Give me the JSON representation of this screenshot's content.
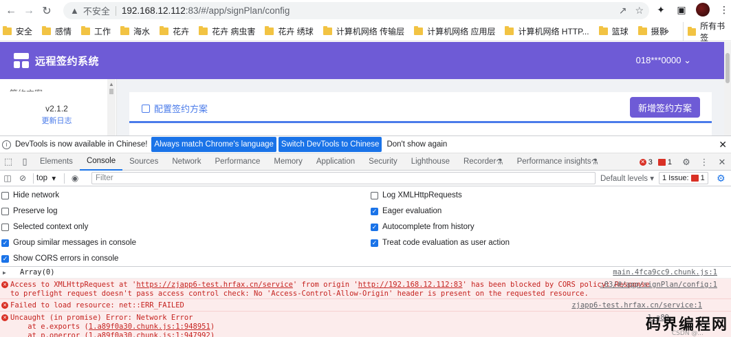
{
  "browser": {
    "not_secure": "不安全",
    "url_host": "192.168.12.112",
    "url_rest": ":83/#/app/signPlan/config",
    "bookmarks": [
      "安全",
      "感情",
      "工作",
      "海水",
      "花卉",
      "花卉 病虫害",
      "花卉 绣球",
      "计算机网络  传输层",
      "计算机网络 应用层",
      "计算机网络 HTTP...",
      "篮球",
      "摄影"
    ],
    "more": "»",
    "all_bookmarks": "所有书签"
  },
  "app": {
    "title": "远程签约系统",
    "user": "018***0000",
    "sidebar_partial": "签约方案",
    "version": "v2.1.2",
    "changelog": "更新日志",
    "config_link": "配置签约方案",
    "add_button": "新增签约方案"
  },
  "infobar": {
    "message": "DevTools is now available in Chinese!",
    "btn_match": "Always match Chrome's language",
    "btn_switch": "Switch DevTools to Chinese",
    "btn_dont": "Don't show again"
  },
  "devtools": {
    "tabs": [
      "Elements",
      "Console",
      "Sources",
      "Network",
      "Performance",
      "Memory",
      "Application",
      "Security",
      "Lighthouse",
      "Recorder",
      "Performance insights"
    ],
    "active_tab": "Console",
    "error_count": "3",
    "issue_count": "1",
    "context": "top",
    "filter_placeholder": "Filter",
    "default_levels": "Default levels",
    "issues_label": "1 Issue:",
    "issues_count": "1"
  },
  "settings": {
    "left": [
      {
        "label": "Hide network",
        "checked": false
      },
      {
        "label": "Preserve log",
        "checked": false
      },
      {
        "label": "Selected context only",
        "checked": false
      },
      {
        "label": "Group similar messages in console",
        "checked": true
      },
      {
        "label": "Show CORS errors in console",
        "checked": true
      }
    ],
    "right": [
      {
        "label": "Log XMLHttpRequests",
        "checked": false
      },
      {
        "label": "Eager evaluation",
        "checked": true
      },
      {
        "label": "Autocomplete from history",
        "checked": true
      },
      {
        "label": "Treat code evaluation as user action",
        "checked": true
      }
    ]
  },
  "console": {
    "m1_text": "Array(0)",
    "m1_src": "main.4fca9cc9.chunk.js:1",
    "m2_a": "Access to XMLHttpRequest at '",
    "m2_link1": "https://zjapp6-test.hrfax.cn/service",
    "m2_b": "' from origin '",
    "m2_link2": "http://192.168.12.112:83",
    "m2_c": "' has been blocked by CORS policy: Response",
    "m2_line2": "to preflight request doesn't pass access control check: No 'Access-Control-Allow-Origin' header is present on the requested resource.",
    "m2_src": ":83/#/app/signPlan/config:1",
    "m3_text": "Failed to load resource: net::ERR_FAILED",
    "m3_src": "zjapp6-test.hrfax.cn/service:1",
    "m4_text": "Uncaught (in promise) Error: Network Error",
    "m4_l2": "    at e.exports (",
    "m4_l2_link": "1.a89f0a30.chunk.js:1:948951",
    "m4_l3": "    at p.onerror (",
    "m4_l3_link": "1.a89f0a30.chunk.js:1:947992",
    "m4_src": "1.a89",
    "watermark": "码界编程网",
    "watermark_sub": "CSDN @..."
  }
}
